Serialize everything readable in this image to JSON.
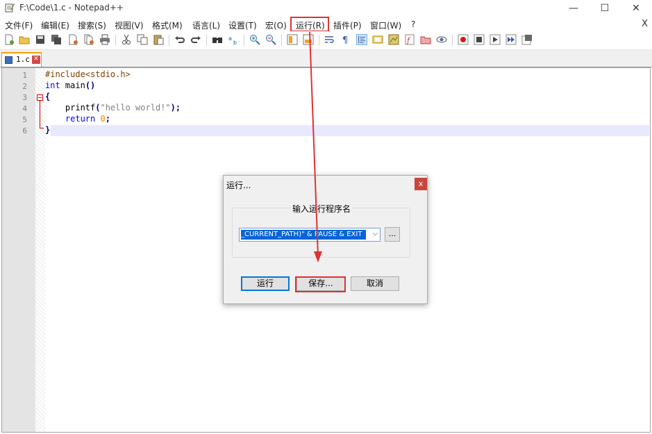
{
  "window": {
    "title": "F:\\Code\\1.c - Notepad++",
    "minimize": "—",
    "maximize": "☐",
    "close": "✕"
  },
  "menu": {
    "items": [
      "文件(F)",
      "编辑(E)",
      "搜索(S)",
      "视图(V)",
      "格式(M)",
      "语言(L)",
      "设置(T)",
      "宏(O)",
      "运行(R)",
      "插件(P)",
      "窗口(W)",
      "?"
    ],
    "close_doc": "X"
  },
  "tab": {
    "label": "1.c"
  },
  "editor": {
    "line_numbers": [
      "1",
      "2",
      "3",
      "4",
      "5",
      "6"
    ]
  },
  "dialog": {
    "title": "运行...",
    "close": "x",
    "group_label": "输入运行程序名",
    "command_value": "_CURRENT_PATH)\" & PAUSE & EXIT",
    "browse_label": "...",
    "run_label": "运行",
    "save_label": "保存...",
    "cancel_label": "取消"
  },
  "colors": {
    "highlight_red": "#e03131",
    "selection_blue": "#0a64d8",
    "current_line": "#e8e8ff"
  }
}
